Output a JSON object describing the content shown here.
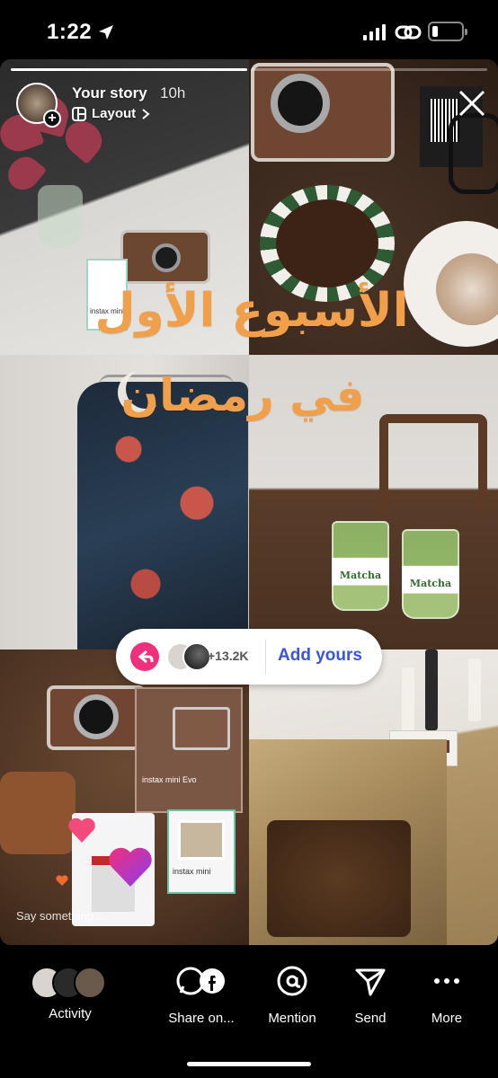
{
  "status_bar": {
    "time": "1:22",
    "icons": [
      "location-arrow-icon",
      "signal-bars-icon",
      "link-icon",
      "battery-icon"
    ],
    "battery_level": 0.2
  },
  "story": {
    "progress_segments": 2,
    "progress_active": 1,
    "header": {
      "title": "Your story",
      "age": "10h",
      "layout_label": "Layout",
      "add_icon": "plus-icon",
      "close_icon": "close-icon"
    },
    "overlay_text": {
      "line1": "الأسبوع الأول",
      "line2": "في رمضان"
    },
    "photo_labels": {
      "instax_pack": "instax mini",
      "matcha1": "Matcha",
      "matcha2": "Matcha",
      "instax_box": "instax mini Evo",
      "instax_film": "instax mini"
    },
    "add_yours": {
      "count": "+13.2K",
      "label": "Add yours",
      "icon": "reply-arrow-icon"
    },
    "comment_placeholder": "Say something..."
  },
  "bottom_bar": {
    "items": [
      {
        "label": "Activity",
        "icon": "activity-avatars"
      },
      {
        "label": "Share on...",
        "icon": "whatsapp-facebook-icon"
      },
      {
        "label": "Mention",
        "icon": "at-icon"
      },
      {
        "label": "Send",
        "icon": "send-icon"
      },
      {
        "label": "More",
        "icon": "more-icon"
      }
    ]
  },
  "colors": {
    "accent_text": "#f0a04b",
    "add_yours_blue": "#3a56d8",
    "add_yours_pink": "#f0307a"
  }
}
